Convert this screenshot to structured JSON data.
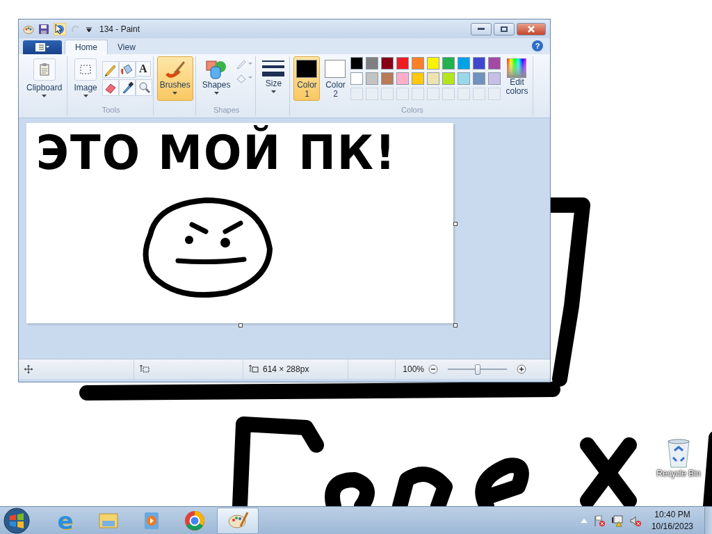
{
  "window": {
    "title": "134 - Paint"
  },
  "tabs": [
    {
      "label": "Home",
      "selected": true
    },
    {
      "label": "View",
      "selected": false
    }
  ],
  "ribbon": {
    "clipboard": "Clipboard",
    "image": "Image",
    "text_tool": "A",
    "tools_group": "Tools",
    "brushes": {
      "label": "Brushes",
      "selected": true
    },
    "shapes": "Shapes",
    "shapes_group": "Shapes",
    "size": "Size",
    "color_slots": [
      {
        "label": "Color",
        "number": "1",
        "color": "#000000",
        "selected": true
      },
      {
        "label": "Color",
        "number": "2",
        "color": "#ffffff",
        "selected": false
      }
    ],
    "palette": [
      {
        "color": "#000000"
      },
      {
        "color": "#7f7f7f"
      },
      {
        "color": "#880015"
      },
      {
        "color": "#ed1c24"
      },
      {
        "color": "#ff7f27"
      },
      {
        "color": "#fff200"
      },
      {
        "color": "#22b14c"
      },
      {
        "color": "#00a2e8"
      },
      {
        "color": "#3f48cc"
      },
      {
        "color": "#a349a4"
      },
      {
        "color": "#ffffff"
      },
      {
        "color": "#c3c3c3"
      },
      {
        "color": "#b97a57"
      },
      {
        "color": "#ffaec9"
      },
      {
        "color": "#ffc90e"
      },
      {
        "color": "#efe4b0"
      },
      {
        "color": "#b5e61d"
      },
      {
        "color": "#99d9ea"
      },
      {
        "color": "#7092be"
      },
      {
        "color": "#c8bfe7"
      }
    ],
    "edit_colors": "Edit colors",
    "colors_group": "Colors"
  },
  "canvas": {
    "handwritten_text": "ЭТО МОЙ ПК!"
  },
  "help_button": {
    "glyph": "?"
  },
  "status_bar": {
    "image_size": "614 × 288px",
    "zoom": "100%",
    "zoom_slider": {
      "level": 0.5
    }
  },
  "desktop": {
    "icons": [
      {
        "label": "Recycle Bin"
      }
    ]
  },
  "taskbar": {
    "apps": [
      {
        "kind": "ie",
        "glyph": "e",
        "selected": false
      },
      {
        "kind": "explorer",
        "selected": false
      },
      {
        "kind": "media",
        "selected": false
      },
      {
        "kind": "chrome",
        "selected": false
      },
      {
        "kind": "paint",
        "selected": true
      }
    ],
    "time": "10:40 PM",
    "date": "10/16/2023"
  }
}
